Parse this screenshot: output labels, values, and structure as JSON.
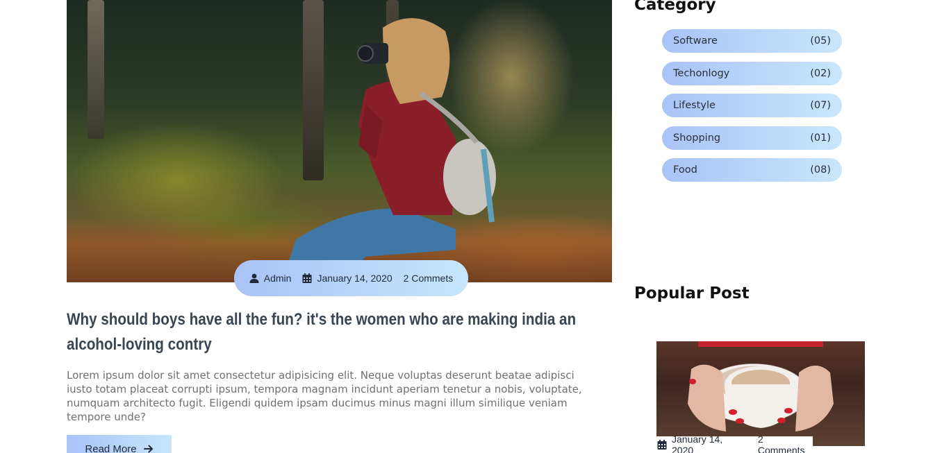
{
  "post": {
    "author": "Admin",
    "date": "January 14, 2020",
    "comments": "2 Commets",
    "title": "Why should boys have all the fun? it's the women who are making india an alcohol-loving contry",
    "excerpt": "Lorem ipsum dolor sit amet consectetur adipisicing elit. Neque voluptas deserunt beatae adipisci iusto totam placeat corrupti ipsum, tempora magnam incidunt aperiam tenetur a nobis, voluptate, numquam architecto fugit. Eligendi quidem ipsam ducimus minus magni illum similique veniam tempore unde?",
    "read_more": "Read More"
  },
  "sidebar": {
    "category_heading": "Category",
    "categories": [
      {
        "name": "Software",
        "count": "(05)"
      },
      {
        "name": "Techonlogy",
        "count": "(02)"
      },
      {
        "name": "Lifestyle",
        "count": "(07)"
      },
      {
        "name": "Shopping",
        "count": "(01)"
      },
      {
        "name": "Food",
        "count": "(08)"
      }
    ],
    "popular_heading": "Popular Post",
    "popular_post": {
      "date": "January 14, 2020",
      "comments": "2 Comments"
    }
  },
  "colors": {
    "pill_gradient_start": "#a9c3f7",
    "pill_gradient_end": "#c6e6fb",
    "title_color": "#3a4553",
    "excerpt_color": "#6f6f6f"
  },
  "icons": {
    "author": "user-icon",
    "date": "calendar-icon",
    "read_more": "arrow-right-icon"
  }
}
